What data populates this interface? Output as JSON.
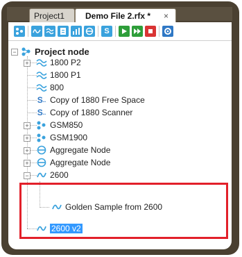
{
  "tabs": [
    {
      "label": "Project1",
      "active": false
    },
    {
      "label": "Demo File 2.rfx *",
      "active": true
    }
  ],
  "tab_close_glyph": "×",
  "toolbar": {
    "buttons": [
      {
        "icon": "network-icon",
        "color": "#3aa2dd"
      },
      {
        "icon": "wave-icon",
        "color": "#3aa2dd"
      },
      {
        "icon": "multi-wave-icon",
        "color": "#3aa2dd"
      },
      {
        "icon": "document-icon",
        "color": "#3aa2dd"
      },
      {
        "icon": "bars-icon",
        "color": "#3aa2dd"
      },
      {
        "icon": "aggregate-icon",
        "color": "#3aa2dd"
      },
      {
        "icon": "scanner-icon",
        "color": "#3aa2dd"
      },
      {
        "icon": "play-icon",
        "color": "#2e9e3a"
      },
      {
        "icon": "fast-forward-icon",
        "color": "#2e9e3a"
      },
      {
        "icon": "stop-icon",
        "color": "#d93434"
      },
      {
        "icon": "settings-icon",
        "color": "#2f78c5"
      }
    ]
  },
  "tree": {
    "root": {
      "label": "Project node",
      "icon": "project-node-icon"
    },
    "items": [
      {
        "label": "1800 P2",
        "icon": "multi-wave-icon",
        "expander": "+"
      },
      {
        "label": "1800 P1",
        "icon": "multi-wave-icon",
        "expander": ""
      },
      {
        "label": "800",
        "icon": "multi-wave-icon",
        "expander": ""
      },
      {
        "label": "Copy of 1880 Free Space",
        "icon": "scanner-s-icon",
        "expander": ""
      },
      {
        "label": "Copy of 1880 Scanner",
        "icon": "scanner-s-icon",
        "expander": ""
      },
      {
        "label": "GSM850",
        "icon": "network-icon",
        "expander": "+"
      },
      {
        "label": "GSM1900",
        "icon": "network-icon",
        "expander": "+"
      },
      {
        "label": "Aggregate Node",
        "icon": "aggregate-icon",
        "expander": "+"
      },
      {
        "label": "Aggregate Node",
        "icon": "aggregate-icon",
        "expander": "+"
      },
      {
        "label": "2600",
        "icon": "wave-icon",
        "expander": "−"
      },
      {
        "label": "Golden Sample from 2600",
        "icon": "wave-icon",
        "expander": "",
        "child": true
      },
      {
        "label": "2600 v2",
        "icon": "wave-icon",
        "expander": "",
        "selected": true
      }
    ]
  },
  "colors": {
    "frame": "#4a4031",
    "highlight": "#e2202a",
    "selection": "#3399ff",
    "icon_blue": "#3aa2dd"
  }
}
